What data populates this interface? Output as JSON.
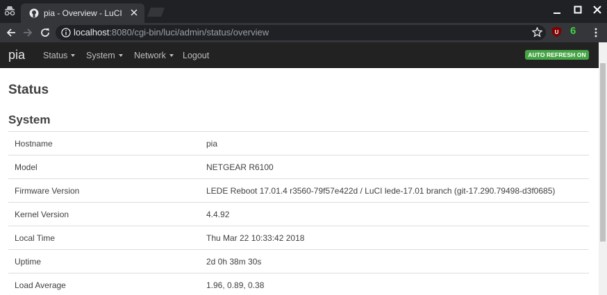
{
  "browser": {
    "tab_title": "pia - Overview - LuCI",
    "url_host": "localhost",
    "url_rest": ":8080/cgi-bin/luci/admin/status/overview",
    "extension_count": "6"
  },
  "navbar": {
    "brand": "pia",
    "menu": [
      {
        "label": "Status",
        "dropdown": true
      },
      {
        "label": "System",
        "dropdown": true
      },
      {
        "label": "Network",
        "dropdown": true
      },
      {
        "label": "Logout",
        "dropdown": false
      }
    ],
    "auto_refresh": "AUTO REFRESH ON"
  },
  "page": {
    "title": "Status",
    "section_title": "System"
  },
  "system_table": [
    {
      "label": "Hostname",
      "value": "pia"
    },
    {
      "label": "Model",
      "value": "NETGEAR R6100"
    },
    {
      "label": "Firmware Version",
      "value": "LEDE Reboot 17.01.4 r3560-79f57e422d / LuCI lede-17.01 branch (git-17.290.79498-d3f0685)"
    },
    {
      "label": "Kernel Version",
      "value": "4.4.92"
    },
    {
      "label": "Local Time",
      "value": "Thu Mar 22 10:33:42 2018"
    },
    {
      "label": "Uptime",
      "value": "2d 0h 38m 30s"
    },
    {
      "label": "Load Average",
      "value": "1.96, 0.89, 0.38"
    }
  ],
  "colors": {
    "navbar_bg": "#222222",
    "badge_green": "#46a546",
    "chrome_dark": "#202124",
    "chrome_toolbar": "#35363a"
  }
}
